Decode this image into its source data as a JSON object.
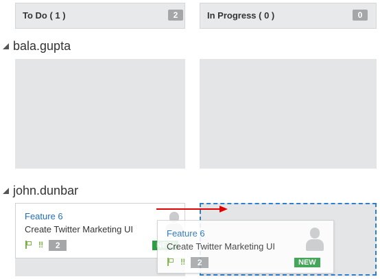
{
  "columns": [
    {
      "title": "To Do ( 1 )",
      "count": "2"
    },
    {
      "title": "In Progress ( 0 )",
      "count": "0"
    }
  ],
  "lanes": [
    {
      "name": "bala.gupta"
    },
    {
      "name": "john.dunbar"
    }
  ],
  "card": {
    "feature": "Feature 6",
    "name": "Create Twitter Marketing UI",
    "points": "2",
    "status": "NEW",
    "status_color": "#2e9e45"
  },
  "drag_card": {
    "feature": "Feature 6",
    "name": "Create Twitter Marketing UI",
    "points": "2",
    "status": "NEW"
  },
  "colors": {
    "accent": "#1f6fb5",
    "drop_zone": "#2b7fd0",
    "drag_arrow": "#e00000"
  }
}
